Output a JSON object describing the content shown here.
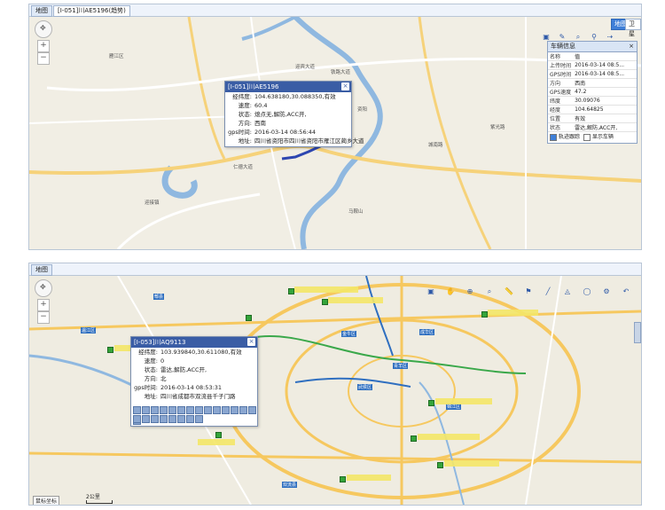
{
  "top": {
    "tabs": [
      {
        "label": "地图"
      },
      {
        "label": "[I-051]川AE5196(趋势)"
      }
    ],
    "maptypes": [
      {
        "label": "地图"
      },
      {
        "label": "卫星"
      }
    ],
    "popup": {
      "title": "[I-051]川AE5196",
      "rows": [
        {
          "k": "经纬度:",
          "v": "104.638180,30.088350,有效"
        },
        {
          "k": "速度:",
          "v": "60.4"
        },
        {
          "k": "状态:",
          "v": "熄点无,解防,ACC开,"
        },
        {
          "k": "方向:",
          "v": "西南"
        },
        {
          "k": "gps时间:",
          "v": "2016-03-14 08:56:44"
        },
        {
          "k": "地址:",
          "v": "四川省资阳市四川省资阳市雁江区蔺乡大道"
        }
      ]
    },
    "info": {
      "title": "车辆信息",
      "header": {
        "k": "名称",
        "v": "值"
      },
      "rows": [
        {
          "k": "上传时间",
          "v": "2016-03-14 08:5..."
        },
        {
          "k": "GPS时间",
          "v": "2016-03-14 08:5..."
        },
        {
          "k": "方向",
          "v": "西南"
        },
        {
          "k": "GPS速度",
          "v": "47.2"
        },
        {
          "k": "纬度",
          "v": "30.09076"
        },
        {
          "k": "经度",
          "v": "104.64825"
        },
        {
          "k": "位置",
          "v": "有效"
        },
        {
          "k": "状态",
          "v": "雷达,解防,ACC开,"
        }
      ],
      "check_track": "轨迹跟踪",
      "check_show": "显示车辆"
    },
    "places": [
      "雁江区",
      "资阳",
      "迎接镇",
      "马鞍山",
      "迎宾大道",
      "铁路大道",
      "城南路",
      "仁德大道",
      "紫光路"
    ]
  },
  "bottom": {
    "tabs": [
      {
        "label": "地图"
      }
    ],
    "popup": {
      "title": "[I-053]川AQ9113",
      "rows": [
        {
          "k": "经纬度:",
          "v": "103.939840,30.611080,有效"
        },
        {
          "k": "速度:",
          "v": "0"
        },
        {
          "k": "状态:",
          "v": "雷达,解防,ACC开,"
        },
        {
          "k": "方向:",
          "v": "北"
        },
        {
          "k": "gps时间:",
          "v": "2016-03-14 08:53:31"
        },
        {
          "k": "地址:",
          "v": "四川省成都市双流县千子门路"
        }
      ]
    },
    "districts": [
      "温江区",
      "金牛区",
      "青羊区",
      "武侯区",
      "锦江区",
      "成华区",
      "双流县",
      "郫县"
    ],
    "scale_label": "2公里",
    "bottom_left": "鼠标坐标"
  }
}
